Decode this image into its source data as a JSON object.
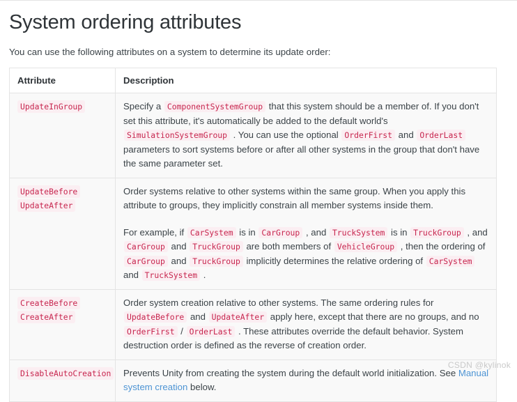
{
  "page": {
    "title": "System ordering attributes",
    "intro": "You can use the following attributes on a system to determine its update order:"
  },
  "table": {
    "headers": {
      "attribute": "Attribute",
      "description": "Description"
    },
    "rows": [
      {
        "attributes": [
          "UpdateInGroup"
        ],
        "paragraphs": [
          [
            {
              "t": "text",
              "v": "Specify a "
            },
            {
              "t": "code",
              "v": "ComponentSystemGroup"
            },
            {
              "t": "text",
              "v": " that this system should be a member of. If you don't set this attribute, it's automatically be added to the default world's "
            },
            {
              "t": "code",
              "v": "SimulationSystemGroup"
            },
            {
              "t": "text",
              "v": " . You can use the optional "
            },
            {
              "t": "code",
              "v": "OrderFirst"
            },
            {
              "t": "text",
              "v": " and "
            },
            {
              "t": "code",
              "v": "OrderLast"
            },
            {
              "t": "text",
              "v": " parameters to sort systems before or after all other systems in the group that don't have the same parameter set."
            }
          ]
        ]
      },
      {
        "attributes": [
          "UpdateBefore",
          "UpdateAfter"
        ],
        "paragraphs": [
          [
            {
              "t": "text",
              "v": "Order systems relative to other systems within the same group. When you apply this attribute to groups, they implicitly constrain all member systems inside them."
            }
          ],
          [
            {
              "t": "text",
              "v": "For example, if "
            },
            {
              "t": "code",
              "v": "CarSystem"
            },
            {
              "t": "text",
              "v": " is in "
            },
            {
              "t": "code",
              "v": "CarGroup"
            },
            {
              "t": "text",
              "v": " , and "
            },
            {
              "t": "code",
              "v": "TruckSystem"
            },
            {
              "t": "text",
              "v": " is in "
            },
            {
              "t": "code",
              "v": "TruckGroup"
            },
            {
              "t": "text",
              "v": " , and "
            },
            {
              "t": "code",
              "v": "CarGroup"
            },
            {
              "t": "text",
              "v": " and "
            },
            {
              "t": "code",
              "v": "TruckGroup"
            },
            {
              "t": "text",
              "v": " are both members of "
            },
            {
              "t": "code",
              "v": "VehicleGroup"
            },
            {
              "t": "text",
              "v": " , then the ordering of "
            },
            {
              "t": "code",
              "v": "CarGroup"
            },
            {
              "t": "text",
              "v": " and "
            },
            {
              "t": "code",
              "v": "TruckGroup"
            },
            {
              "t": "text",
              "v": " implicitly determines the relative ordering of "
            },
            {
              "t": "code",
              "v": "CarSystem"
            },
            {
              "t": "text",
              "v": " and "
            },
            {
              "t": "code",
              "v": "TruckSystem"
            },
            {
              "t": "text",
              "v": " ."
            }
          ]
        ]
      },
      {
        "attributes": [
          "CreateBefore",
          "CreateAfter"
        ],
        "paragraphs": [
          [
            {
              "t": "text",
              "v": "Order system creation relative to other systems. The same ordering rules for "
            },
            {
              "t": "code",
              "v": "UpdateBefore"
            },
            {
              "t": "text",
              "v": " and "
            },
            {
              "t": "code",
              "v": "UpdateAfter"
            },
            {
              "t": "text",
              "v": " apply here, except that there are no groups, and no "
            },
            {
              "t": "code",
              "v": "OrderFirst"
            },
            {
              "t": "text",
              "v": " / "
            },
            {
              "t": "code",
              "v": "OrderLast"
            },
            {
              "t": "text",
              "v": " . These attributes override the default behavior. System destruction order is defined as the reverse of creation order."
            }
          ]
        ]
      },
      {
        "attributes": [
          "DisableAutoCreation"
        ],
        "paragraphs": [
          [
            {
              "t": "text",
              "v": "Prevents Unity from creating the system during the default world initialization. See "
            },
            {
              "t": "link",
              "v": "Manual system creation"
            },
            {
              "t": "text",
              "v": " below."
            }
          ]
        ]
      }
    ]
  },
  "watermark": "CSDN @kylinok",
  "colors": {
    "code_text": "#c7254e",
    "code_bg": "#fbeef2",
    "link": "#4d94d4",
    "heading": "#2f3438",
    "body_text": "#3b4348",
    "table_border": "#e4e4e4",
    "cell_bg": "#f9f9f9",
    "header_bg": "#ffffff",
    "watermark": "#c9c9c9"
  }
}
